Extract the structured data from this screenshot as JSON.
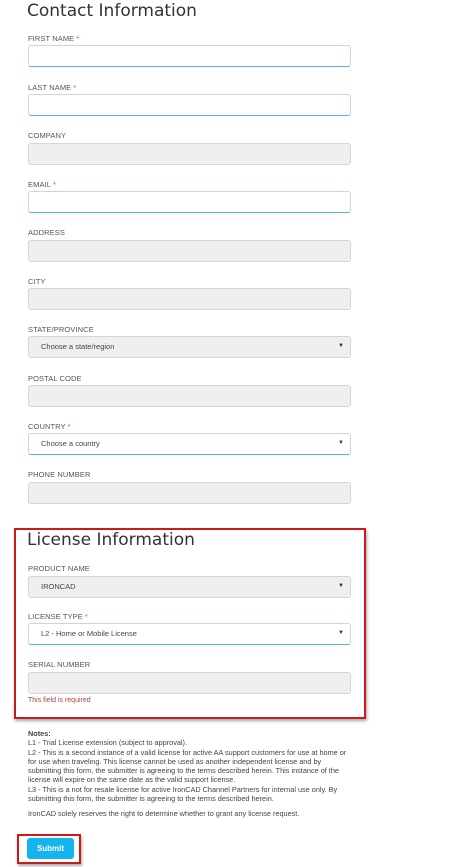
{
  "contact": {
    "title": "Contact Information",
    "fields": {
      "first_name": {
        "label": "FIRST NAME",
        "required_mark": "*",
        "value": ""
      },
      "last_name": {
        "label": "LAST NAME",
        "required_mark": "*",
        "value": ""
      },
      "company": {
        "label": "COMPANY",
        "value": ""
      },
      "email": {
        "label": "EMAIL",
        "required_mark": "*",
        "value": ""
      },
      "address": {
        "label": "ADDRESS",
        "value": ""
      },
      "city": {
        "label": "CITY",
        "value": ""
      },
      "state": {
        "label": "STATE/PROVINCE",
        "selected": "Choose a state/region"
      },
      "postal": {
        "label": "POSTAL CODE",
        "value": ""
      },
      "country": {
        "label": "COUNTRY",
        "required_mark": "*",
        "selected": "Choose a country"
      },
      "phone": {
        "label": "PHONE NUMBER",
        "value": ""
      }
    }
  },
  "license": {
    "title": "License Information",
    "product": {
      "label": "PRODUCT NAME",
      "selected": "IRONCAD"
    },
    "license_type": {
      "label": "LICENSE TYPE",
      "required_mark": "*",
      "selected": "L2 - Home or Mobile License"
    },
    "serial": {
      "label": "SERIAL NUMBER",
      "value": "",
      "error": "This field is required"
    }
  },
  "notes": {
    "title": "Notes:",
    "l1": "L1 - Trial License extension (subject to approval).",
    "l2": "L2 - This is a second instance of a valid license for active AA support customers for use at home or for use when traveling. This license cannot be used as another independent license and by submitting this form, the submitter is agreeing to the terms described herein. This instance of the license will expire on the same date as the valid support license.",
    "l3": "L3 - This is a not for resale license for active IronCAD Channel Partners for internal use only. By submitting this form, the submitter is agreeing to the terms described herein.",
    "footer": "IronCAD solely reserves the right to determine whether to grant any license request."
  },
  "submit": {
    "label": "Submit"
  },
  "colors": {
    "accent": "#14b4ee",
    "highlight_border": "#cc1a1a",
    "error": "#a94442"
  }
}
